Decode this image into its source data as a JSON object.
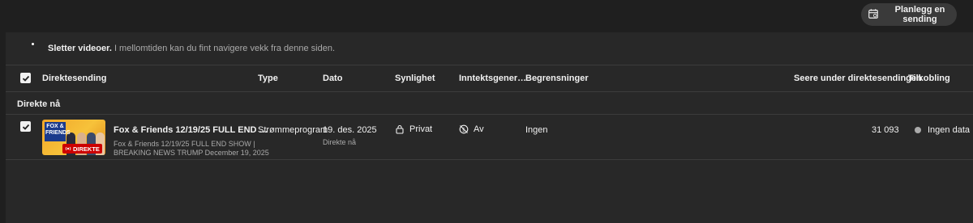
{
  "topbar": {
    "schedule_button_label": "Planlegg en sending"
  },
  "notice": {
    "bold": "Sletter videoer.",
    "text": "I mellomtiden kan du fint navigere vekk fra denne siden."
  },
  "table": {
    "columns": {
      "stream": "Direktesending",
      "type": "Type",
      "date": "Dato",
      "visibility": "Synlighet",
      "monetization": "Inntektsgener…",
      "restrictions": "Begrensninger",
      "viewers": "Seere under direktesendingen",
      "connection": "Tilkobling"
    },
    "section_label": "Direkte nå",
    "rows": [
      {
        "thumbnail": {
          "logo_text": "FOX & FRIENDS",
          "badge": "DIREKTE"
        },
        "title": "Fox & Friends 12/19/25 FULL END …",
        "description_line1": "Fox & Friends 12/19/25 FULL END SHOW |",
        "description_line2": "BREAKING NEWS TRUMP December 19, 2025",
        "type": "Strømmeprogram",
        "date": "19. des. 2025",
        "date_sub": "Direkte nå",
        "visibility": "Privat",
        "monetization": "Av",
        "restrictions": "Ingen",
        "viewers": "31 093",
        "connection": "Ingen data",
        "connection_color": "#aaaaaa"
      }
    ]
  },
  "colors": {
    "background": "#1f1f1f",
    "panel": "#282828",
    "live_red": "#cc0000",
    "button": "#3a3a3a"
  }
}
